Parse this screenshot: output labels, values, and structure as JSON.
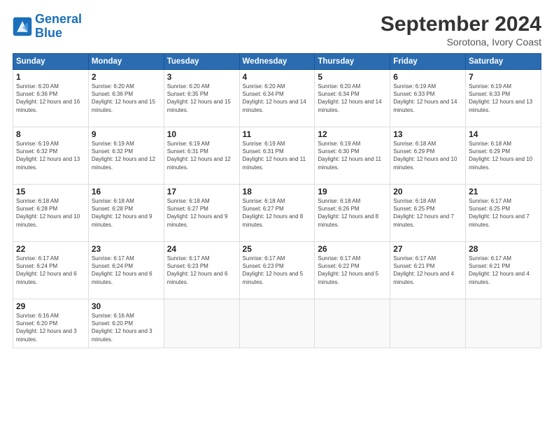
{
  "header": {
    "logo_line1": "General",
    "logo_line2": "Blue",
    "month": "September 2024",
    "location": "Sorotona, Ivory Coast"
  },
  "weekdays": [
    "Sunday",
    "Monday",
    "Tuesday",
    "Wednesday",
    "Thursday",
    "Friday",
    "Saturday"
  ],
  "weeks": [
    [
      {
        "day": "1",
        "sunrise": "6:20 AM",
        "sunset": "6:36 PM",
        "daylight": "12 hours and 16 minutes."
      },
      {
        "day": "2",
        "sunrise": "6:20 AM",
        "sunset": "6:36 PM",
        "daylight": "12 hours and 15 minutes."
      },
      {
        "day": "3",
        "sunrise": "6:20 AM",
        "sunset": "6:35 PM",
        "daylight": "12 hours and 15 minutes."
      },
      {
        "day": "4",
        "sunrise": "6:20 AM",
        "sunset": "6:34 PM",
        "daylight": "12 hours and 14 minutes."
      },
      {
        "day": "5",
        "sunrise": "6:20 AM",
        "sunset": "6:34 PM",
        "daylight": "12 hours and 14 minutes."
      },
      {
        "day": "6",
        "sunrise": "6:19 AM",
        "sunset": "6:33 PM",
        "daylight": "12 hours and 14 minutes."
      },
      {
        "day": "7",
        "sunrise": "6:19 AM",
        "sunset": "6:33 PM",
        "daylight": "12 hours and 13 minutes."
      }
    ],
    [
      {
        "day": "8",
        "sunrise": "6:19 AM",
        "sunset": "6:32 PM",
        "daylight": "12 hours and 13 minutes."
      },
      {
        "day": "9",
        "sunrise": "6:19 AM",
        "sunset": "6:32 PM",
        "daylight": "12 hours and 12 minutes."
      },
      {
        "day": "10",
        "sunrise": "6:19 AM",
        "sunset": "6:31 PM",
        "daylight": "12 hours and 12 minutes."
      },
      {
        "day": "11",
        "sunrise": "6:19 AM",
        "sunset": "6:31 PM",
        "daylight": "12 hours and 11 minutes."
      },
      {
        "day": "12",
        "sunrise": "6:19 AM",
        "sunset": "6:30 PM",
        "daylight": "12 hours and 11 minutes."
      },
      {
        "day": "13",
        "sunrise": "6:18 AM",
        "sunset": "6:29 PM",
        "daylight": "12 hours and 10 minutes."
      },
      {
        "day": "14",
        "sunrise": "6:18 AM",
        "sunset": "6:29 PM",
        "daylight": "12 hours and 10 minutes."
      }
    ],
    [
      {
        "day": "15",
        "sunrise": "6:18 AM",
        "sunset": "6:28 PM",
        "daylight": "12 hours and 10 minutes."
      },
      {
        "day": "16",
        "sunrise": "6:18 AM",
        "sunset": "6:28 PM",
        "daylight": "12 hours and 9 minutes."
      },
      {
        "day": "17",
        "sunrise": "6:18 AM",
        "sunset": "6:27 PM",
        "daylight": "12 hours and 9 minutes."
      },
      {
        "day": "18",
        "sunrise": "6:18 AM",
        "sunset": "6:27 PM",
        "daylight": "12 hours and 8 minutes."
      },
      {
        "day": "19",
        "sunrise": "6:18 AM",
        "sunset": "6:26 PM",
        "daylight": "12 hours and 8 minutes."
      },
      {
        "day": "20",
        "sunrise": "6:18 AM",
        "sunset": "6:25 PM",
        "daylight": "12 hours and 7 minutes."
      },
      {
        "day": "21",
        "sunrise": "6:17 AM",
        "sunset": "6:25 PM",
        "daylight": "12 hours and 7 minutes."
      }
    ],
    [
      {
        "day": "22",
        "sunrise": "6:17 AM",
        "sunset": "6:24 PM",
        "daylight": "12 hours and 6 minutes."
      },
      {
        "day": "23",
        "sunrise": "6:17 AM",
        "sunset": "6:24 PM",
        "daylight": "12 hours and 6 minutes."
      },
      {
        "day": "24",
        "sunrise": "6:17 AM",
        "sunset": "6:23 PM",
        "daylight": "12 hours and 6 minutes."
      },
      {
        "day": "25",
        "sunrise": "6:17 AM",
        "sunset": "6:23 PM",
        "daylight": "12 hours and 5 minutes."
      },
      {
        "day": "26",
        "sunrise": "6:17 AM",
        "sunset": "6:22 PM",
        "daylight": "12 hours and 5 minutes."
      },
      {
        "day": "27",
        "sunrise": "6:17 AM",
        "sunset": "6:21 PM",
        "daylight": "12 hours and 4 minutes."
      },
      {
        "day": "28",
        "sunrise": "6:17 AM",
        "sunset": "6:21 PM",
        "daylight": "12 hours and 4 minutes."
      }
    ],
    [
      {
        "day": "29",
        "sunrise": "6:16 AM",
        "sunset": "6:20 PM",
        "daylight": "12 hours and 3 minutes."
      },
      {
        "day": "30",
        "sunrise": "6:16 AM",
        "sunset": "6:20 PM",
        "daylight": "12 hours and 3 minutes."
      },
      {
        "day": "",
        "sunrise": "",
        "sunset": "",
        "daylight": ""
      },
      {
        "day": "",
        "sunrise": "",
        "sunset": "",
        "daylight": ""
      },
      {
        "day": "",
        "sunrise": "",
        "sunset": "",
        "daylight": ""
      },
      {
        "day": "",
        "sunrise": "",
        "sunset": "",
        "daylight": ""
      },
      {
        "day": "",
        "sunrise": "",
        "sunset": "",
        "daylight": ""
      }
    ]
  ]
}
